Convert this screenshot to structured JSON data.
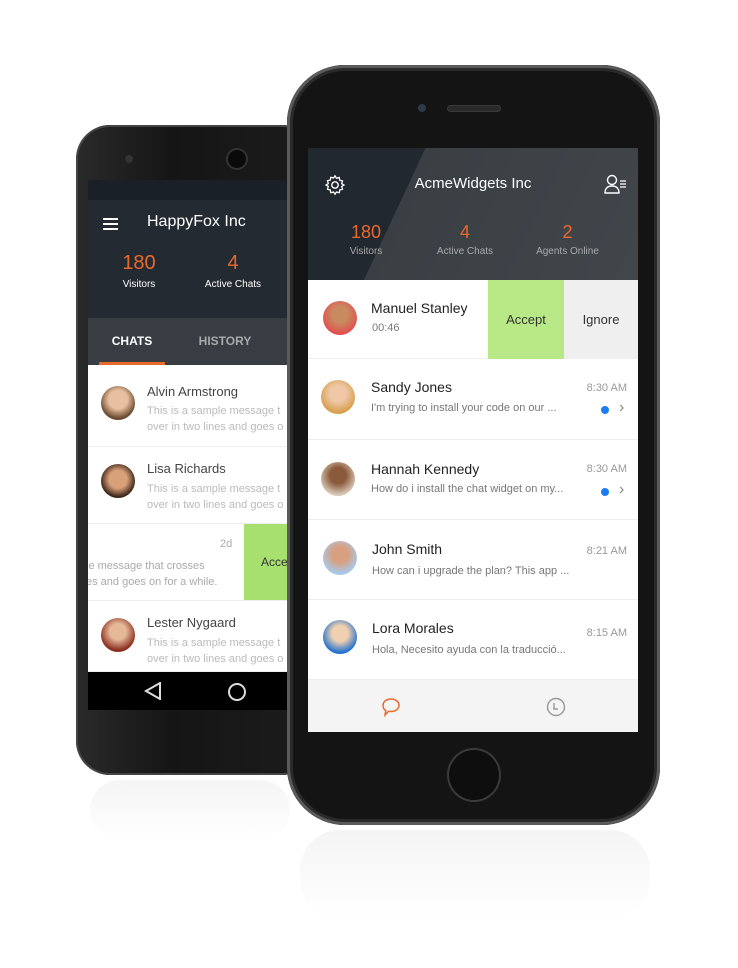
{
  "android": {
    "title": "HappyFox Inc",
    "stats": [
      {
        "value": "180",
        "label": "Visitors"
      },
      {
        "value": "4",
        "label": "Active Chats"
      }
    ],
    "tabs": [
      {
        "label": "CHATS",
        "active": true
      },
      {
        "label": "HISTORY",
        "active": false
      }
    ],
    "chats": [
      {
        "name": "Alvin Armstrong",
        "message_line1": "This is a sample message t",
        "message_line2": "over in two lines and goes o"
      },
      {
        "name": "Lisa Richards",
        "message_line1": "This is a sample message t",
        "message_line2": "over in two lines and goes o"
      },
      {
        "time": "2d",
        "message_line1": "le message that crosses",
        "message_line2": "es and goes on for a while.",
        "accept_label": "Acce"
      },
      {
        "name": "Lester Nygaard",
        "message_line1": "This is a sample message t",
        "message_line2": "over in two lines and goes o"
      }
    ],
    "accent": "#e8692c"
  },
  "iphone": {
    "title": "AcmeWidgets Inc",
    "stats": [
      {
        "value": "180",
        "label": "Visitors"
      },
      {
        "value": "4",
        "label": "Active Chats"
      },
      {
        "value": "2",
        "label": "Agents Online"
      }
    ],
    "incoming": {
      "name": "Manuel Stanley",
      "timer": "00:46",
      "accept_label": "Accept",
      "ignore_label": "Ignore"
    },
    "chats": [
      {
        "name": "Sandy Jones",
        "message": "I'm trying to install your code on our ...",
        "time": "8:30 AM",
        "unread": true
      },
      {
        "name": "Hannah Kennedy",
        "message": "How do i install the chat widget on my...",
        "time": "8:30 AM",
        "unread": true
      },
      {
        "name": "John Smith",
        "message": "How can i upgrade the plan? This app ...",
        "time": "8:21 AM",
        "unread": false
      },
      {
        "name": "Lora Morales",
        "message": "Hola, Necesito ayuda con la traducció...",
        "time": "8:15 AM",
        "unread": false
      }
    ],
    "accent": "#e8692c",
    "accept_color": "#b8e986",
    "unread_color": "#1e7cf2"
  }
}
